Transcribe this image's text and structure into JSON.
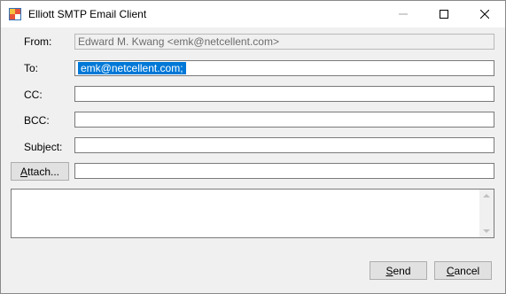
{
  "window": {
    "title": "Elliott SMTP Email Client",
    "icon": "app-window-icon",
    "controls": [
      "minimize-icon",
      "maximize-icon",
      "close-icon"
    ]
  },
  "form": {
    "from_label": "From:",
    "from_value": "Edward M. Kwang <emk@netcellent.com>",
    "to_label": "To:",
    "to_value": "emk@netcellent.com;",
    "cc_label": "CC:",
    "cc_value": "",
    "bcc_label": "BCC:",
    "bcc_value": "",
    "subject_label": "Subject:",
    "subject_value": "",
    "attach_button_rest": "ttach...",
    "attach_button_mnemonic": "A",
    "attach_value": "",
    "body_value": ""
  },
  "footer": {
    "send_mnemonic": "S",
    "send_rest": "end",
    "cancel_mnemonic": "C",
    "cancel_rest": "ancel"
  },
  "colors": {
    "selection": "#0078d7",
    "window_bg": "#f0f0f0"
  }
}
